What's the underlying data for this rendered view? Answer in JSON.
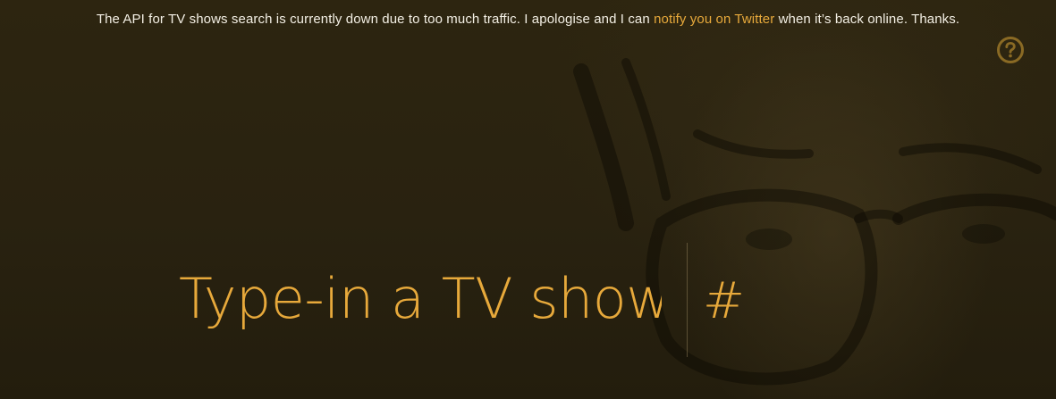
{
  "notice": {
    "text_before": "The API for TV shows search is currently down due to too much traffic. I apologise and I can ",
    "link_text": "notify you on Twitter",
    "text_after": " when it’s back online. Thanks."
  },
  "help": {
    "icon": "question-circle-icon"
  },
  "search": {
    "placeholder": "Type-in a TV show",
    "value": ""
  },
  "hash_button": {
    "label": "#"
  },
  "colors": {
    "background": "#2a2310",
    "accent": "#e7a93b",
    "text": "#f3efe4"
  }
}
